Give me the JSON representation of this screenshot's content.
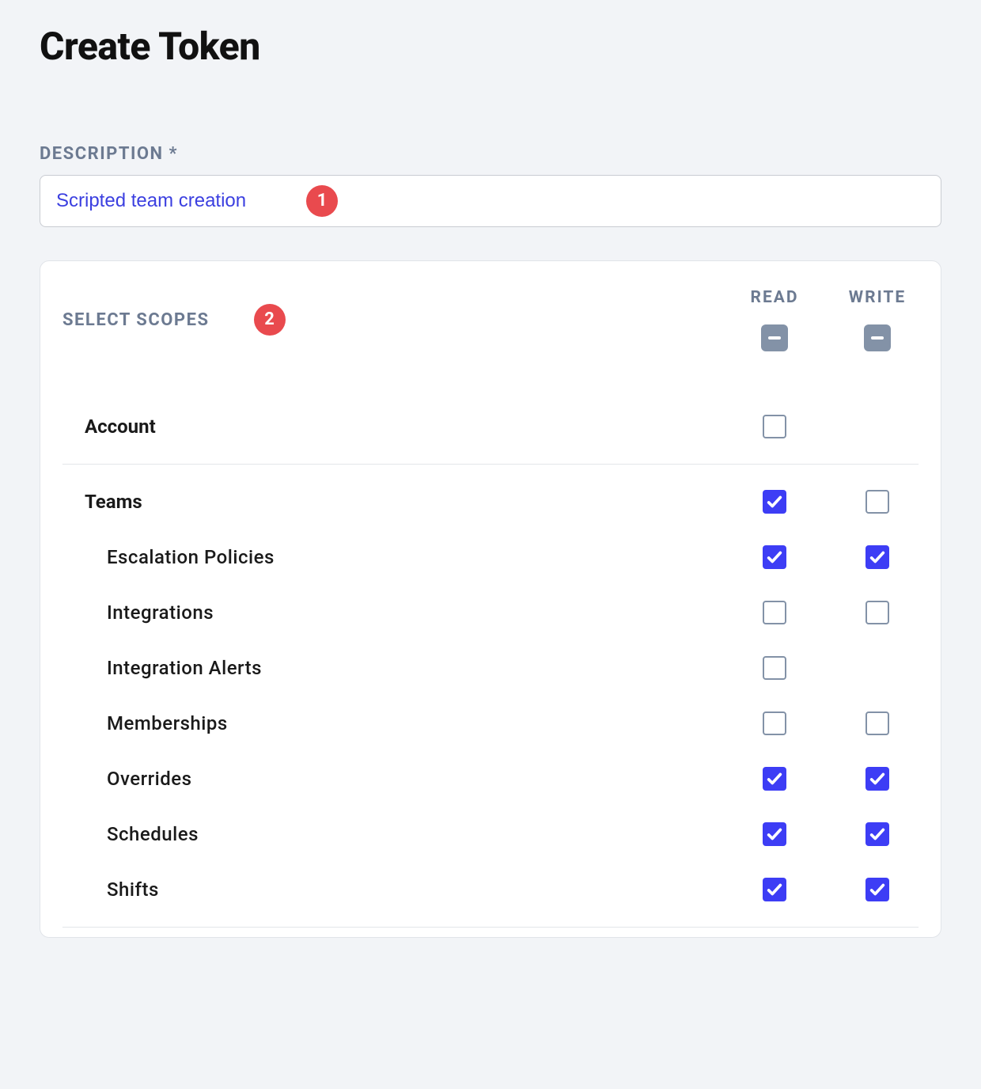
{
  "title": "Create Token",
  "description": {
    "label": "DESCRIPTION *",
    "value": "Scripted team creation"
  },
  "annotations": {
    "badge1": "1",
    "badge2": "2"
  },
  "scopes": {
    "label": "SELECT SCOPES",
    "columns": {
      "read": "READ",
      "write": "WRITE"
    },
    "header_state": {
      "read": "indeterminate",
      "write": "indeterminate"
    },
    "sections": [
      {
        "label": "Account",
        "read": false,
        "write": null,
        "children": []
      },
      {
        "label": "Teams",
        "read": true,
        "write": false,
        "children": [
          {
            "label": "Escalation Policies",
            "read": true,
            "write": true
          },
          {
            "label": "Integrations",
            "read": false,
            "write": false
          },
          {
            "label": "Integration Alerts",
            "read": false,
            "write": null
          },
          {
            "label": "Memberships",
            "read": false,
            "write": false
          },
          {
            "label": "Overrides",
            "read": true,
            "write": true
          },
          {
            "label": "Schedules",
            "read": true,
            "write": true
          },
          {
            "label": "Shifts",
            "read": true,
            "write": true
          }
        ]
      }
    ]
  }
}
